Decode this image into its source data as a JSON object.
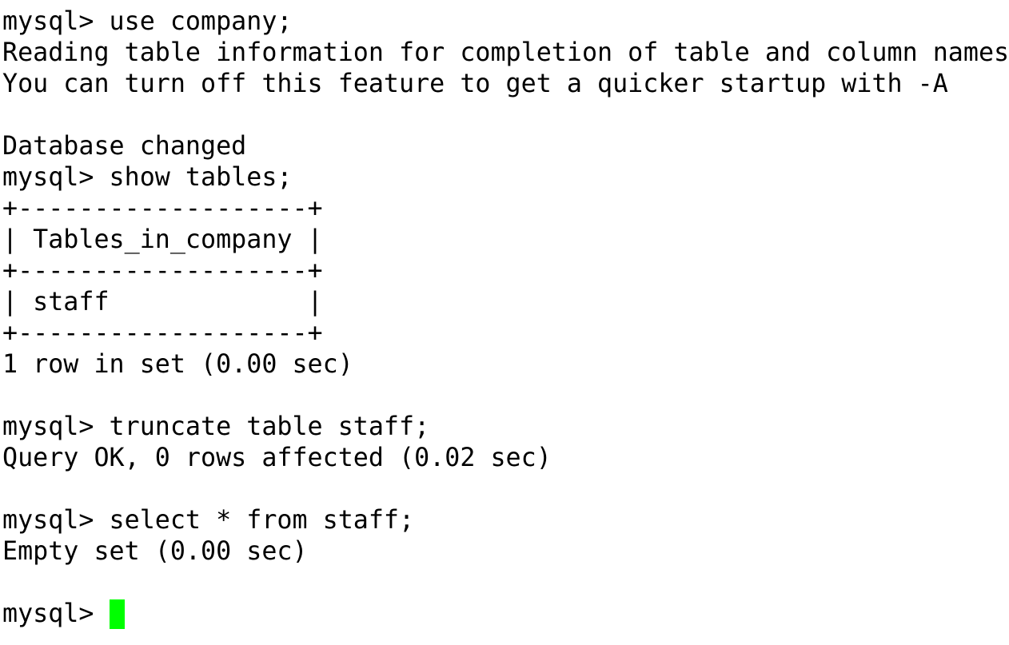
{
  "terminal": {
    "lines": [
      "mysql> use company;",
      "Reading table information for completion of table and column names",
      "You can turn off this feature to get a quicker startup with -A",
      "",
      "Database changed",
      "mysql> show tables;",
      "+-------------------+",
      "| Tables_in_company |",
      "+-------------------+",
      "| staff             |",
      "+-------------------+",
      "1 row in set (0.00 sec)",
      "",
      "mysql> truncate table staff;",
      "Query OK, 0 rows affected (0.02 sec)",
      "",
      "mysql> select * from staff;",
      "Empty set (0.00 sec)",
      ""
    ],
    "prompt": "mysql> ",
    "cursor_color": "#00ff00",
    "text_color": "#000000",
    "background_color": "#ffffff"
  }
}
